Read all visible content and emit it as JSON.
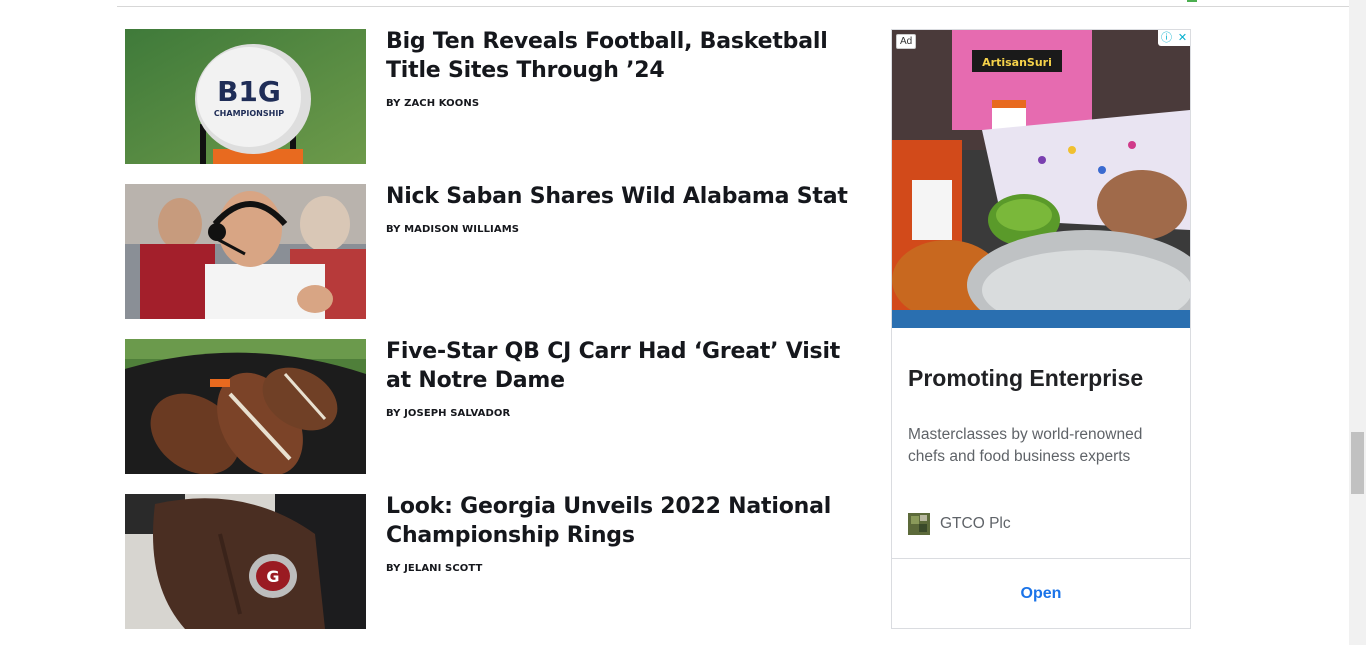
{
  "articles": [
    {
      "headline": "Big Ten Reveals Football, Basketball Title Sites Through ’24",
      "byline": "BY ZACH KOONS",
      "image": "big-ten-championship-pylon"
    },
    {
      "headline": "Nick Saban Shares Wild Alabama Stat",
      "byline": "BY MADISON WILLIAMS",
      "image": "nick-saban-headset"
    },
    {
      "headline": "Five-Star QB CJ Carr Had ‘Great’ Visit at Notre Dame",
      "byline": "BY JOSEPH SALVADOR",
      "image": "footballs-in-bag"
    },
    {
      "headline": "Look: Georgia Unveils 2022 National Championship Rings",
      "byline": "BY JELANI SCOTT",
      "image": "georgia-championship-ring"
    }
  ],
  "thumb_text": {
    "pylon_brand": "B1G",
    "pylon_caption": "CHAMPIONSHIP",
    "ring_letter": "G"
  },
  "ad": {
    "badge": "Ad",
    "choices_info": "ⓘ",
    "choices_close": "✕",
    "image_text": "ArtisanSuri",
    "title": "Promoting Enterprise",
    "description": "Masterclasses by world-renowned chefs and food business experts",
    "advertiser": "GTCO Plc",
    "cta": "Open"
  },
  "colors": {
    "headline": "#15171c",
    "cta": "#1a73e8",
    "ad_text": "#5f6368"
  }
}
